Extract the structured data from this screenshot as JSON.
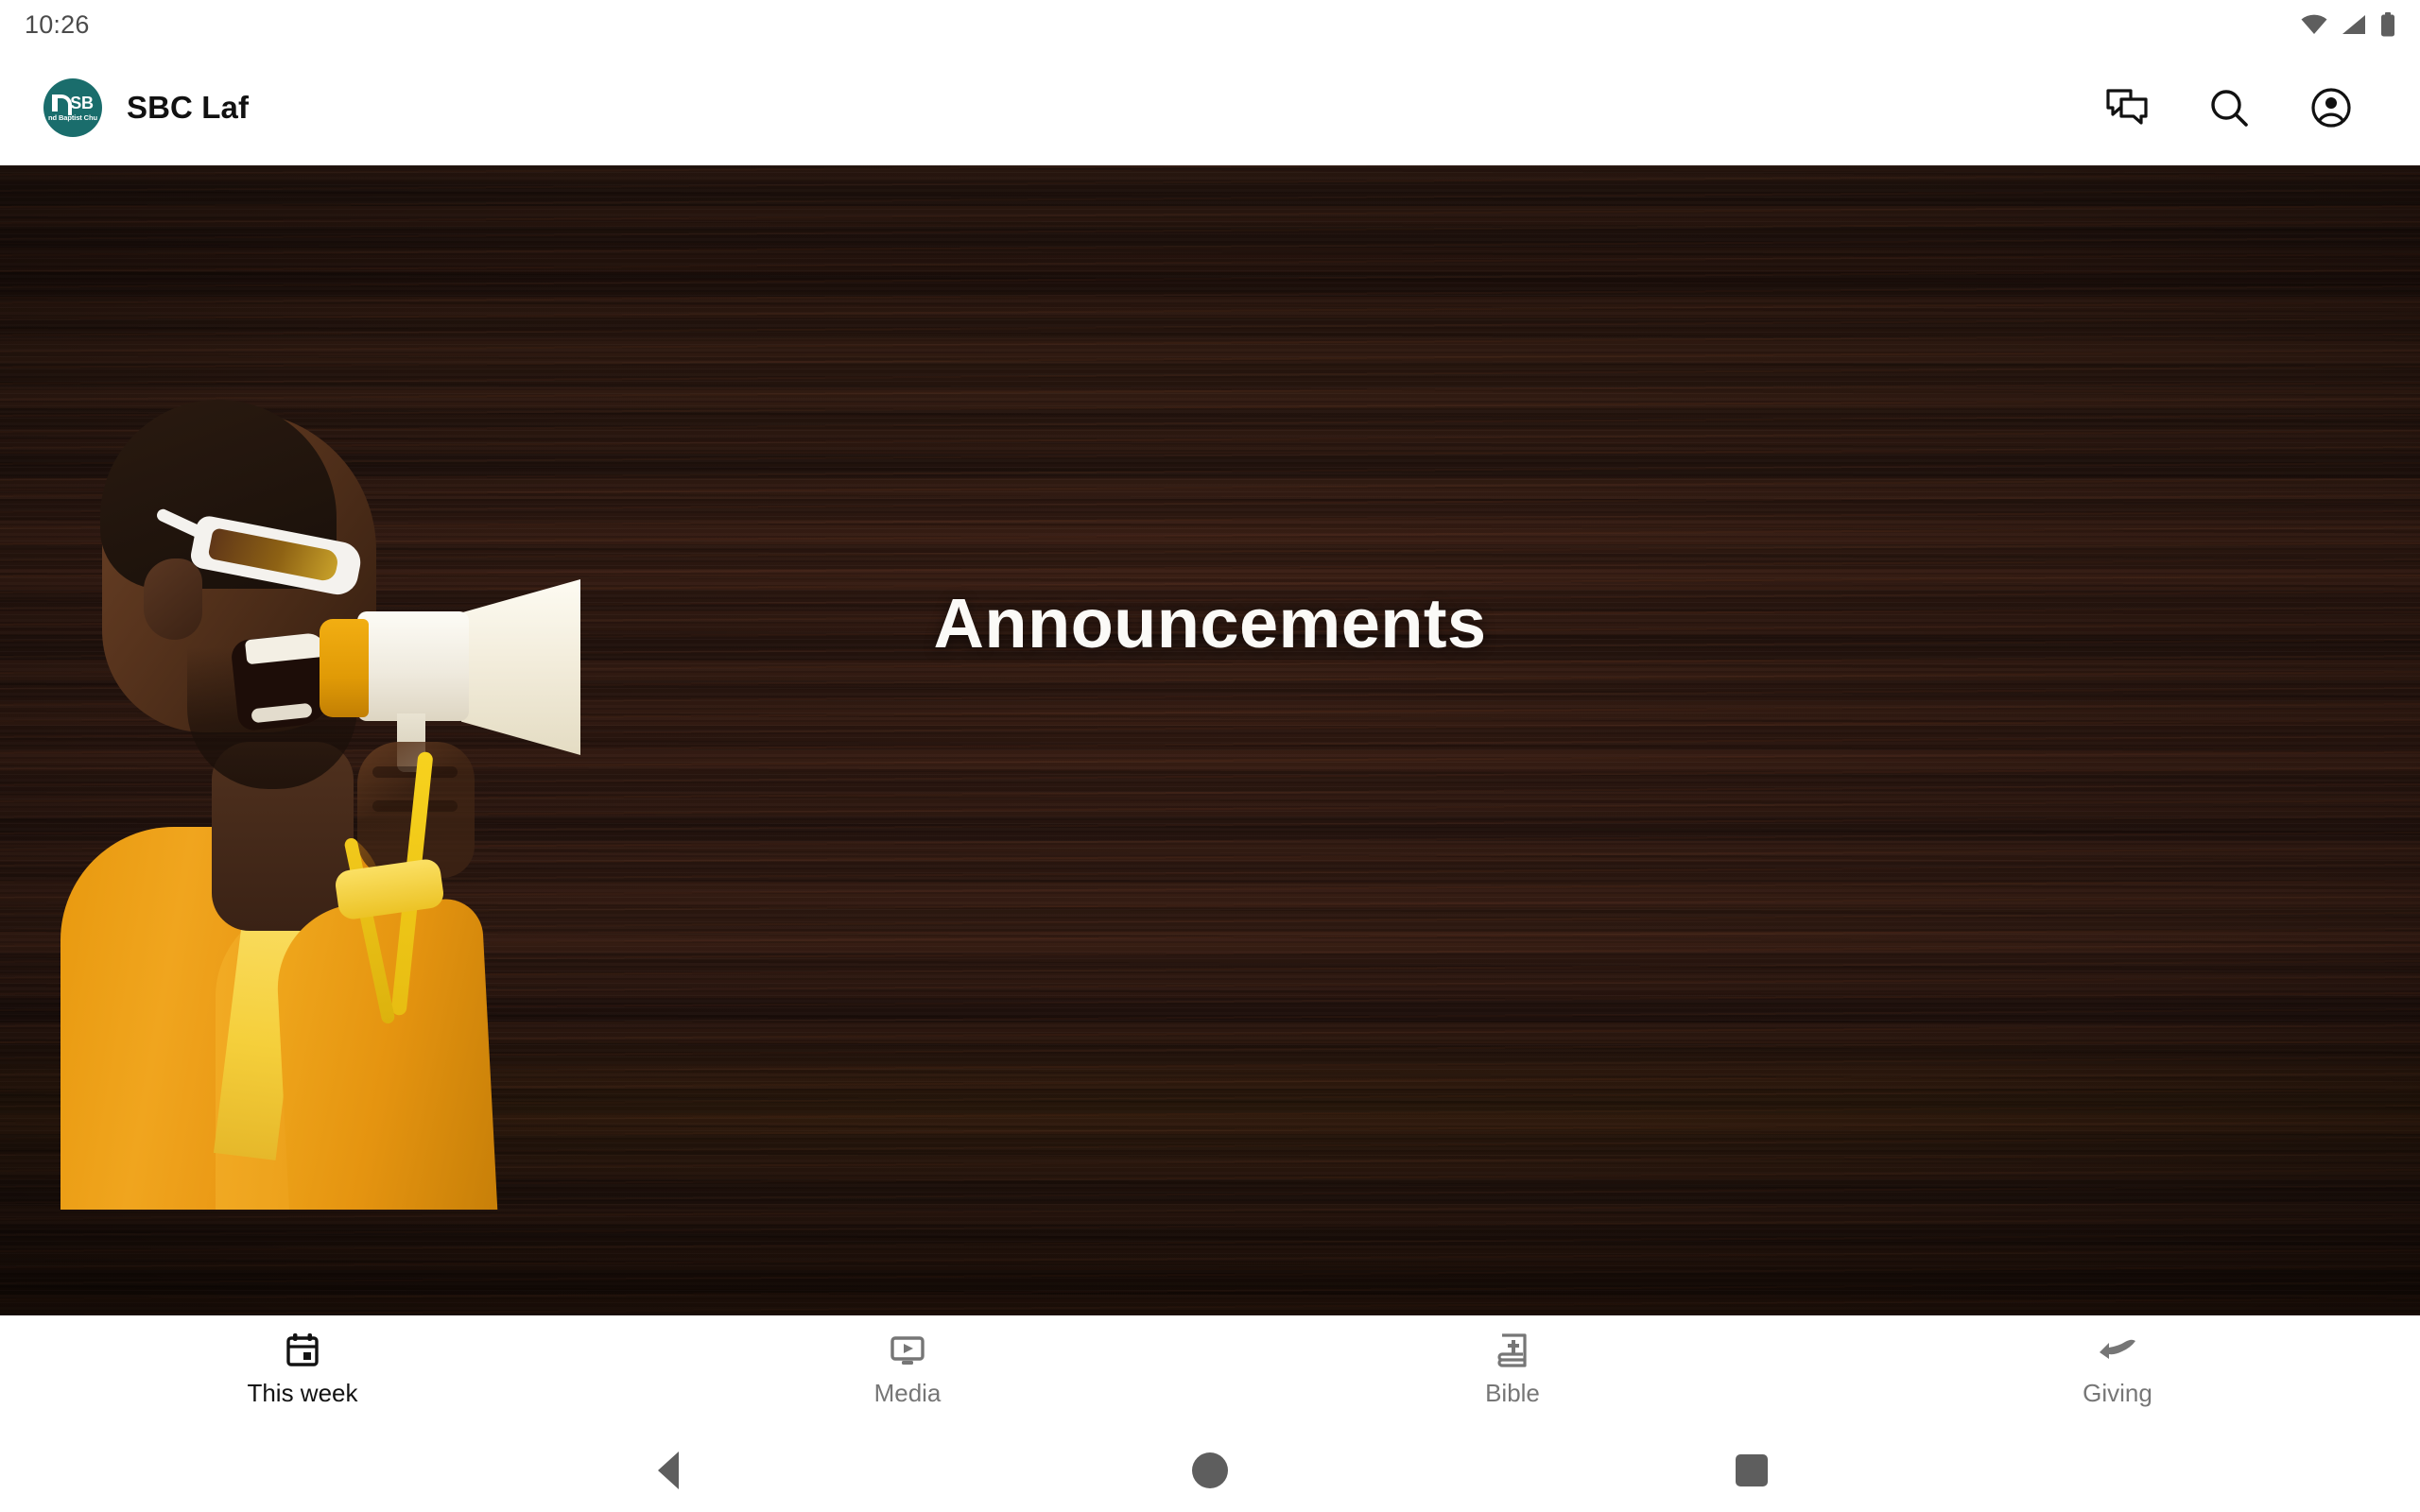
{
  "status_bar": {
    "time": "10:26",
    "icons": [
      "wifi-icon",
      "cellular-signal-icon",
      "battery-icon"
    ]
  },
  "app_bar": {
    "logo": {
      "name": "sbc-logo",
      "initials": "SB",
      "subtext": "nd Baptist Chu",
      "background_color": "#1a6d6c"
    },
    "title": "SBC Laf",
    "actions": [
      {
        "name": "messages-icon",
        "label": "Messages"
      },
      {
        "name": "search-icon",
        "label": "Search"
      },
      {
        "name": "account-icon",
        "label": "Account"
      }
    ]
  },
  "hero": {
    "title": "Announcements",
    "background": "dark-wood-texture",
    "photo_description": "man-with-megaphone",
    "card_color": "#cb2a22"
  },
  "bottom_nav": {
    "items": [
      {
        "label": "This week",
        "icon": "calendar-icon",
        "active": true
      },
      {
        "label": "Media",
        "icon": "media-play-icon",
        "active": false
      },
      {
        "label": "Bible",
        "icon": "bible-book-icon",
        "active": false
      },
      {
        "label": "Giving",
        "icon": "giving-hand-icon",
        "active": false
      }
    ]
  },
  "system_nav": {
    "back": "back-button",
    "home": "home-button",
    "recents": "recents-button"
  },
  "colors": {
    "brand_teal": "#1a6d6c",
    "accent_red": "#cb2a22",
    "active_text": "#131313",
    "inactive_text": "#767676"
  }
}
